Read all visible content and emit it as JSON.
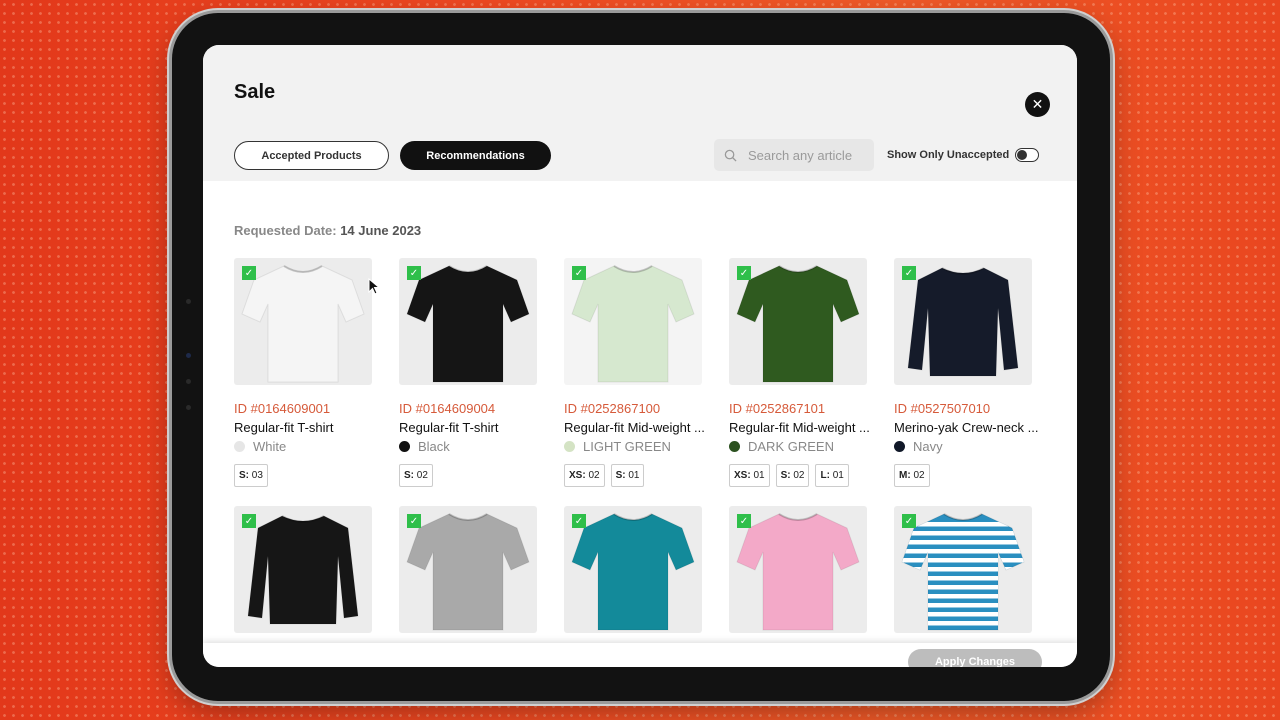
{
  "modal": {
    "title": "Sale",
    "tabs": [
      {
        "label": "Accepted Products",
        "active": false
      },
      {
        "label": "Recommendations",
        "active": true
      }
    ],
    "search": {
      "placeholder": "Search any article"
    },
    "toggle": {
      "label": "Show Only Unaccepted",
      "on": false
    },
    "requested_date": {
      "label": "Requested Date:",
      "value": "14 June 2023"
    },
    "apply_button": "Apply Changes"
  },
  "products": [
    {
      "id": "ID #0164609001",
      "name": "Regular-fit T-shirt",
      "color_name": "White",
      "swatch": "#e6e6e6",
      "garment_color": "#f5f5f5",
      "garment": "tee",
      "sizes": [
        {
          "size": "S:",
          "qty": "03"
        }
      ]
    },
    {
      "id": "ID #0164609004",
      "name": "Regular-fit T-shirt",
      "color_name": "Black",
      "swatch": "#111111",
      "garment_color": "#151515",
      "garment": "tee",
      "sizes": [
        {
          "size": "S:",
          "qty": "02"
        }
      ]
    },
    {
      "id": "ID #0252867100",
      "name": "Regular-fit Mid-weight ...",
      "color_name": "LIGHT GREEN",
      "swatch": "#d4e3c4",
      "garment_color": "#d6e8cf",
      "garment": "tee",
      "sizes": [
        {
          "size": "XS:",
          "qty": "02"
        },
        {
          "size": "S:",
          "qty": "01"
        }
      ]
    },
    {
      "id": "ID #0252867101",
      "name": "Regular-fit Mid-weight ...",
      "color_name": "DARK GREEN",
      "swatch": "#2c5220",
      "garment_color": "#2f5a1f",
      "garment": "tee",
      "sizes": [
        {
          "size": "XS:",
          "qty": "01"
        },
        {
          "size": "S:",
          "qty": "02"
        },
        {
          "size": "L:",
          "qty": "01"
        }
      ]
    },
    {
      "id": "ID #0527507010",
      "name": "Merino-yak Crew-neck ...",
      "color_name": "Navy",
      "swatch": "#101828",
      "garment_color": "#151b2a",
      "garment": "sweater",
      "sizes": [
        {
          "size": "M:",
          "qty": "02"
        }
      ]
    },
    {
      "garment_color": "#161616",
      "garment": "sweater"
    },
    {
      "garment_color": "#a9a9a9",
      "garment": "tee"
    },
    {
      "garment_color": "#138a9a",
      "garment": "tee"
    },
    {
      "garment_color": "#f3a9c8",
      "garment": "tee"
    },
    {
      "garment_color": "#2a8fc0",
      "garment": "striped"
    }
  ]
}
